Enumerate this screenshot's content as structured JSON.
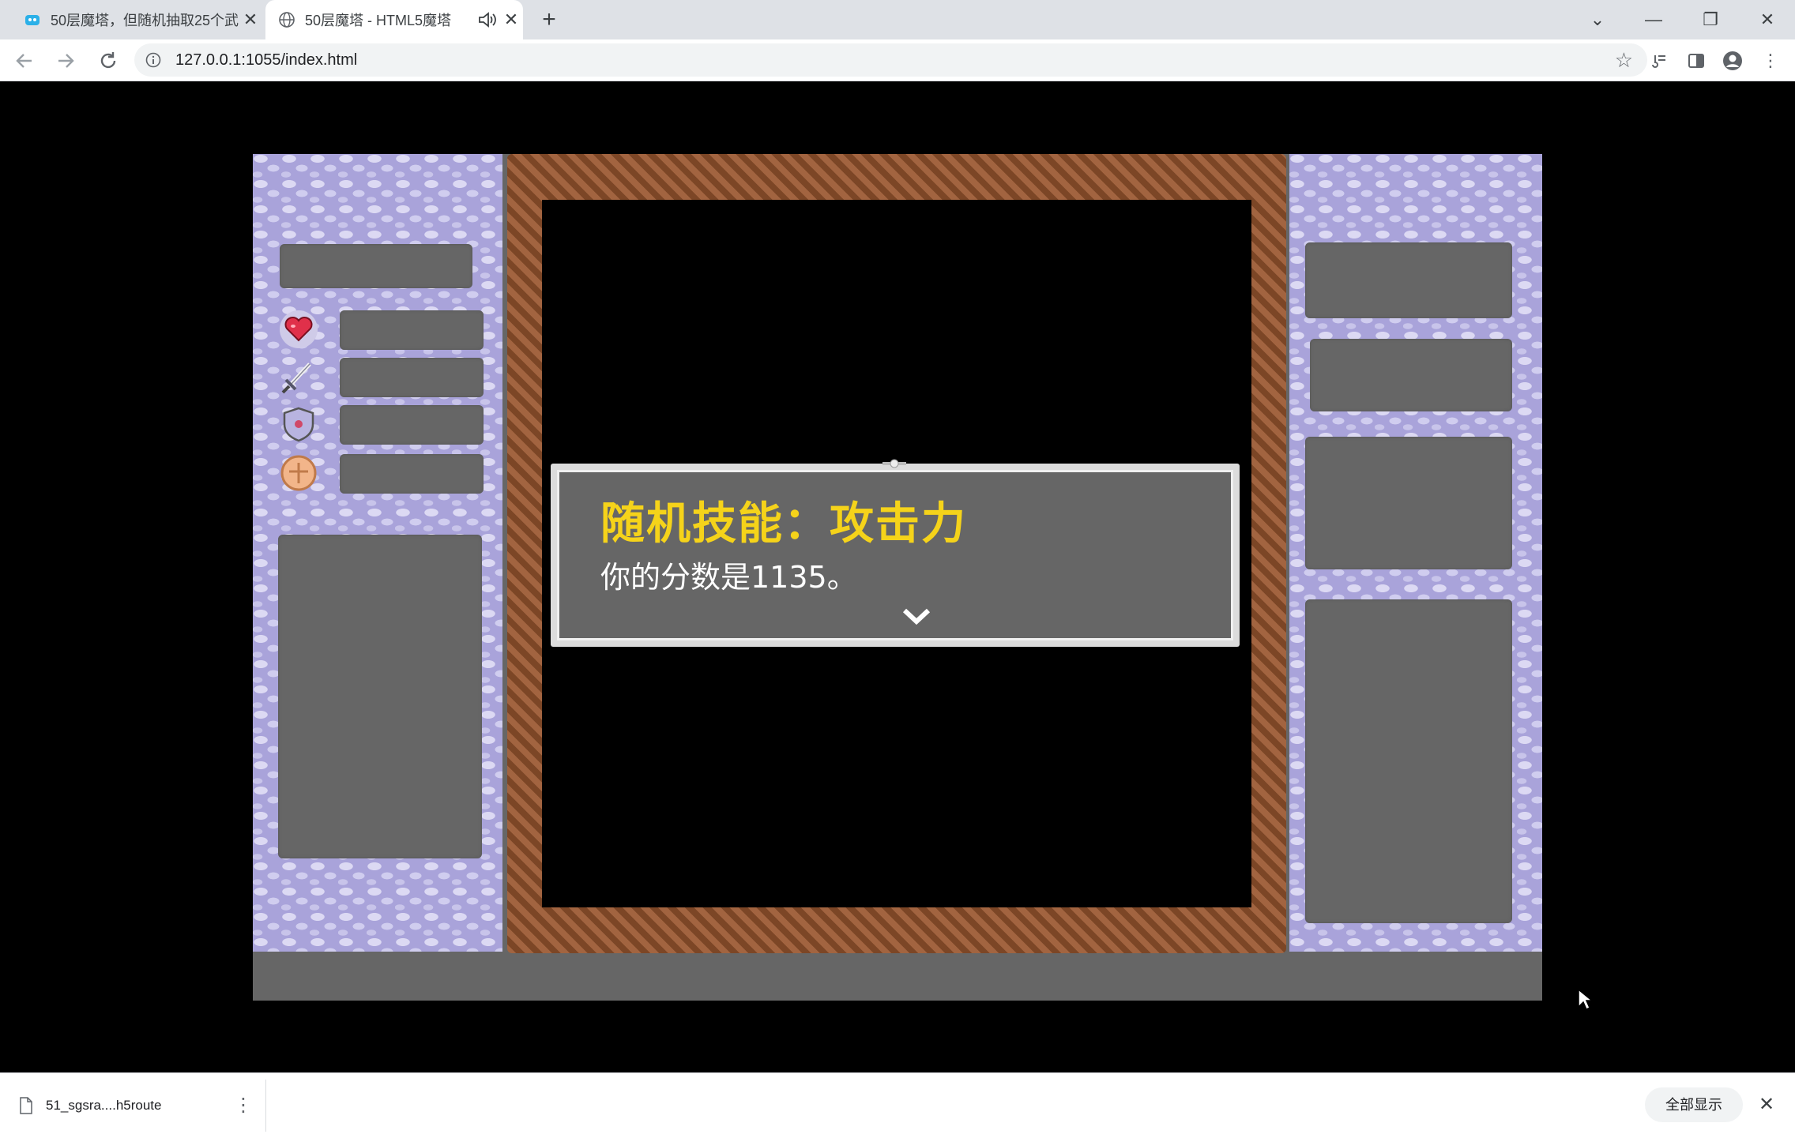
{
  "browser": {
    "tabs": [
      {
        "title": "50层魔塔，但随机抽取25个武",
        "close": "✕",
        "active": false
      },
      {
        "title": "50层魔塔 - HTML5魔塔",
        "close": "✕",
        "active": true
      }
    ],
    "new_tab": "+",
    "url": "127.0.0.1:1055/index.html",
    "window_controls": {
      "dropdown": "⌄",
      "minimize": "—",
      "restore": "❐",
      "close": "✕"
    }
  },
  "game": {
    "dialog": {
      "title": "随机技能：攻击力",
      "text": "你的分数是1135。"
    },
    "colors": {
      "dialog_title": "#f5d31a",
      "panel": "#a9a3da",
      "frame": "#8a5230",
      "slot": "#666666"
    }
  },
  "downloads": {
    "file_name": "51_sgsra....h5route",
    "more": "⋮",
    "show_all": "全部显示",
    "close": "✕"
  }
}
